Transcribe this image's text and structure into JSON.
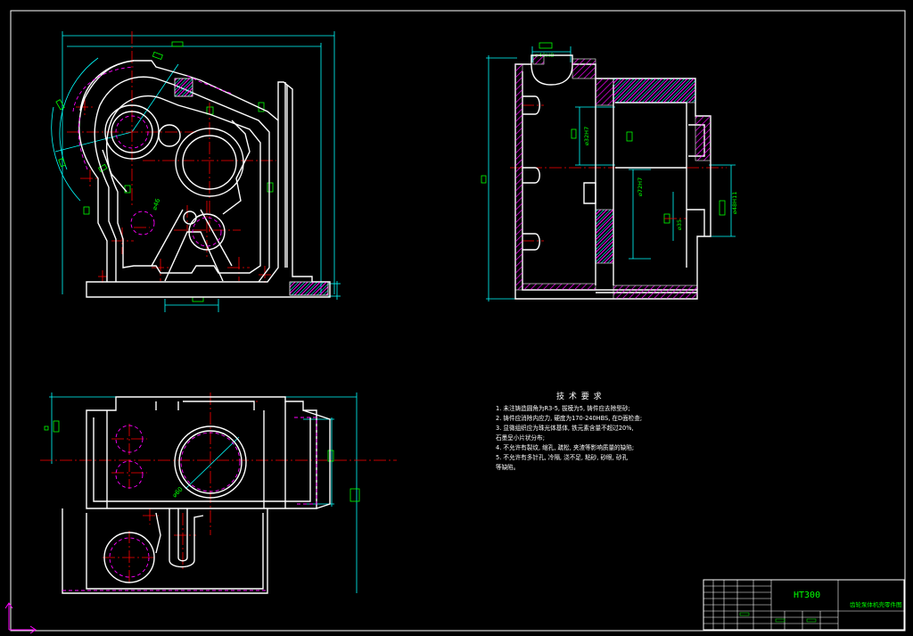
{
  "technical_requirements": {
    "title": "技 术 要 求",
    "items": [
      "1. 未注铸造圆角为R3-5, 拔模为5, 铸件应去除型砂;",
      "2. 铸件应消除内应力, 硬度为170-240HBS, 在D面检查;",
      "3. 显微组织应为珠光体基体, 铁元素含量不超过20%,",
      "   石墨呈小片状分布;",
      "4. 不允许有裂纹, 缩孔, 疏松, 夹渣等影响质量的缺陷;",
      "5. 不允许有多针孔, 冷隔, 浇不足, 粘砂, 砂眼, 砂孔",
      "   等缺陷。"
    ]
  },
  "title_block": {
    "material": "HT300",
    "drawing_name": "齿轮泵体机壳零件图"
  },
  "dimension_labels": {
    "left_top": "⌀46",
    "left_bottom_circle": "⌀60",
    "right_top": "⌀40H8",
    "right_mid1": "⌀32H7",
    "right_mid2": "⌀72H7",
    "right_mid3": "⌀35",
    "right_mid4": "⌀48H11"
  },
  "colors": {
    "background": "#000000",
    "outline": "#ffffff",
    "dimension": "#00ffff",
    "center_line": "#ff0000",
    "hidden": "#ff00ff",
    "text": "#00ff00",
    "hatch": "#ff00ff",
    "hatch_cyan": "#00ffff"
  }
}
